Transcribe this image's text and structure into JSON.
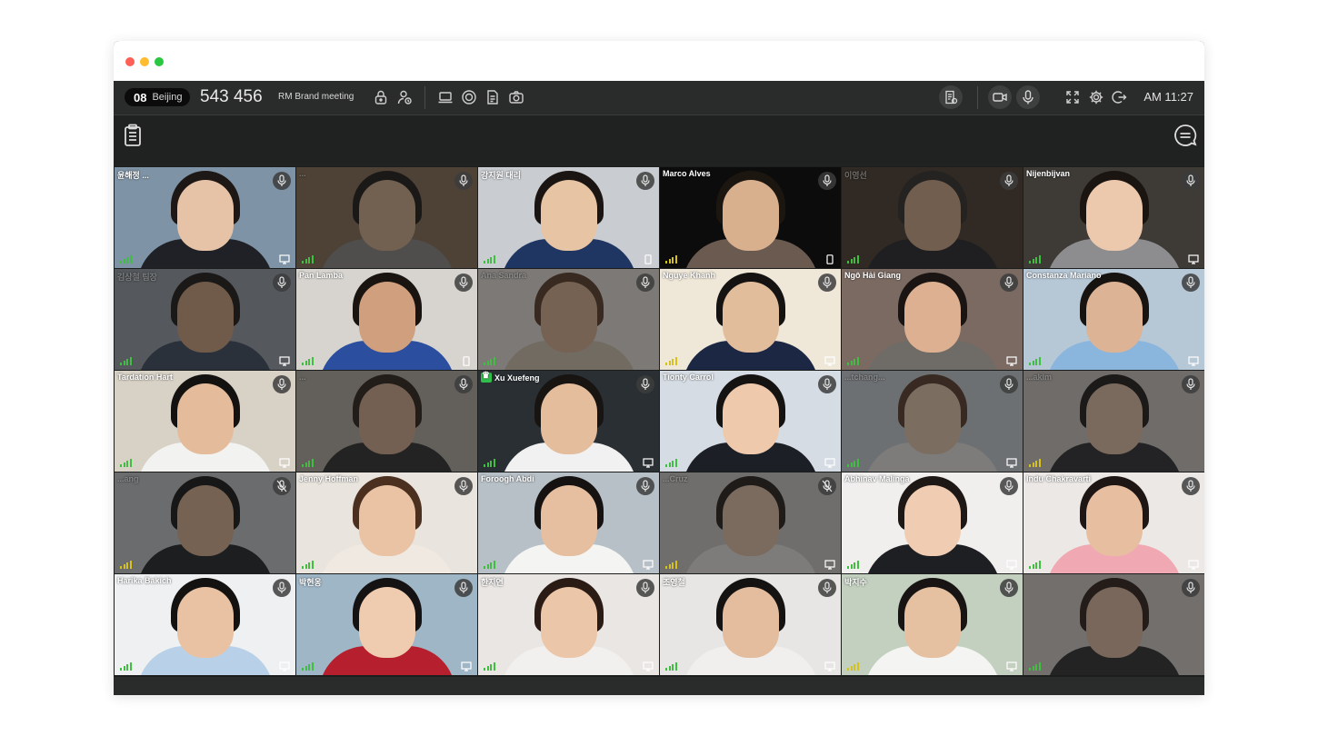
{
  "window_controls": [
    {
      "name": "close",
      "color": "#fe5f57"
    },
    {
      "name": "minimize",
      "color": "#febc2e"
    },
    {
      "name": "maximize",
      "color": "#28c840"
    }
  ],
  "toolbar": {
    "room_number": "08",
    "room_city": "Beijing",
    "meeting_id": "543 456",
    "meeting_name": "RM Brand meeting",
    "clock": "AM 11:27",
    "left_icons": [
      "lock-icon",
      "participants-icon"
    ],
    "center_icons": [
      "laptop-share-icon",
      "record-icon",
      "document-icon",
      "camera-icon"
    ],
    "right_icons": [
      "notes-icon",
      "video-icon",
      "mic-icon",
      "fullscreen-icon",
      "settings-icon",
      "exit-icon"
    ]
  },
  "subbar": {
    "left_icon": "clipboard-icon",
    "right_icon": "chat-icon"
  },
  "colors": {
    "signal_green": "#3fbf3f",
    "signal_yellow": "#d6c21b",
    "host_badge": "#2fbf4a"
  },
  "participants": [
    {
      "name": "윤해정 ...",
      "dim": false,
      "signal": "green",
      "device": "monitor",
      "mic": "on",
      "bg": "#7e93a5",
      "skin": "#e6c2a6",
      "hair": "#1d1715",
      "clothes": "#1f2126"
    },
    {
      "name": "...",
      "dim": true,
      "signal": "green",
      "device": "none",
      "mic": "on",
      "bg": "#8a6f56",
      "skin": "#d9b48f",
      "hair": "#1a1410",
      "clothes": "#8e8a86"
    },
    {
      "name": "강지원 대리",
      "dim": false,
      "signal": "green",
      "device": "tablet",
      "mic": "on",
      "bg": "#c9ccd0",
      "skin": "#e7c4a3",
      "hair": "#1a1512",
      "clothes": "#1f3562"
    },
    {
      "name": "Marco Alves",
      "dim": false,
      "signal": "yellow",
      "device": "tablet",
      "mic": "on",
      "bg": "#0c0c0c",
      "skin": "#d9b08e",
      "hair": "#1c1611",
      "clothes": "#6b5a4f"
    },
    {
      "name": "이영선",
      "dim": true,
      "signal": "green",
      "device": "none",
      "mic": "on",
      "bg": "#4a3b2e",
      "skin": "#d7ad8a",
      "hair": "#2e2a26",
      "clothes": "#222326"
    },
    {
      "name": "Nijenbijvan",
      "dim": false,
      "signal": "green",
      "device": "monitor",
      "mic": "on",
      "bg": "#3e3a36",
      "skin": "#ecc8ad",
      "hair": "#1b1512",
      "clothes": "#8d8c8e"
    },
    {
      "name": "김상철 팀장",
      "dim": true,
      "signal": "green",
      "device": "monitor",
      "mic": "on",
      "bg": "#9aa3ac",
      "skin": "#d4a582",
      "hair": "#191513",
      "clothes": "#3a4a5e"
    },
    {
      "name": "Pan Lamba",
      "dim": false,
      "signal": "green",
      "device": "tablet",
      "mic": "on",
      "bg": "#d7d4cf",
      "skin": "#cf9f7e",
      "hair": "#1a1411",
      "clothes": "#2b4f9e"
    },
    {
      "name": "Ana Sandra",
      "dim": true,
      "signal": "green",
      "device": "none",
      "mic": "on",
      "bg": "#efe9e2",
      "skin": "#e0b796",
      "hair": "#5a3a27",
      "clothes": "#d9c9b6"
    },
    {
      "name": "Nguye Khanh",
      "dim": false,
      "signal": "yellow",
      "device": "monitor",
      "mic": "on",
      "bg": "#efe8d9",
      "skin": "#e1bd9c",
      "hair": "#151312",
      "clothes": "#1c2744"
    },
    {
      "name": "Ngô Hải Giang",
      "dim": false,
      "signal": "green",
      "device": "monitor",
      "mic": "on",
      "bg": "#7a6a62",
      "skin": "#dcb090",
      "hair": "#1a1512",
      "clothes": "#6f6b66"
    },
    {
      "name": "Constanza Mariano",
      "dim": false,
      "signal": "green",
      "device": "monitor",
      "mic": "on",
      "bg": "#b6c7d6",
      "skin": "#dcb394",
      "hair": "#171311",
      "clothes": "#8ab5dd"
    },
    {
      "name": "Tardation Hart",
      "dim": false,
      "signal": "green",
      "device": "monitor",
      "mic": "on",
      "bg": "#d8d1c6",
      "skin": "#e4bc9b",
      "hair": "#141211",
      "clothes": "#f2f2f0"
    },
    {
      "name": "...",
      "dim": true,
      "signal": "green",
      "device": "none",
      "mic": "on",
      "bg": "#b9b2a9",
      "skin": "#dbb292",
      "hair": "#2a1e16",
      "clothes": "#2d2b2a"
    },
    {
      "name": "Xu Xuefeng",
      "host": true,
      "dim": false,
      "signal": "green",
      "device": "monitor",
      "mic": "on",
      "bg": "#2a2f33",
      "skin": "#e3bd9c",
      "hair": "#181412",
      "clothes": "#f1f1f1"
    },
    {
      "name": "Tionty Carrol",
      "dim": false,
      "signal": "green",
      "device": "monitor",
      "mic": "on",
      "bg": "#d6dce4",
      "skin": "#eec9ac",
      "hair": "#151212",
      "clothes": "#1c1f26"
    },
    {
      "name": "...tchang...",
      "dim": true,
      "signal": "green",
      "device": "monitor",
      "mic": "on",
      "bg": "#cfd6dc",
      "skin": "#efcfb4",
      "hair": "#5a3b28",
      "clothes": "#f1efec"
    },
    {
      "name": "...akim",
      "dim": true,
      "signal": "yellow",
      "device": "none",
      "mic": "on",
      "bg": "#d2ccc7",
      "skin": "#ebc8ae",
      "hair": "#1b1514",
      "clothes": "#2b2c30"
    },
    {
      "name": "...ang",
      "dim": true,
      "signal": "yellow",
      "device": "none",
      "mic": "off",
      "bg": "#c8cccf",
      "skin": "#dfb596",
      "hair": "#131110",
      "clothes": "#1e1f22"
    },
    {
      "name": "Jenny Hoffman",
      "dim": false,
      "signal": "green",
      "device": "none",
      "mic": "on",
      "bg": "#e9e4de",
      "skin": "#e9c3a4",
      "hair": "#4b2f1f",
      "clothes": "#efe9e1"
    },
    {
      "name": "Foroogh Abdi",
      "dim": false,
      "signal": "green",
      "device": "monitor",
      "mic": "on",
      "bg": "#b7c0c6",
      "skin": "#e5bf9f",
      "hair": "#151211",
      "clothes": "#f4f4f2"
    },
    {
      "name": "...Cruz",
      "dim": true,
      "signal": "yellow",
      "device": "monitor",
      "mic": "off",
      "bg": "#d4d1cd",
      "skin": "#ecc9ad",
      "hair": "#231a15",
      "clothes": "#f1efec"
    },
    {
      "name": "Abhinav Malinga",
      "dim": false,
      "signal": "green",
      "device": "monitor",
      "mic": "on",
      "bg": "#f0efee",
      "skin": "#f0cdb2",
      "hair": "#1d1716",
      "clothes": "#1e1f22"
    },
    {
      "name": "Indu Chakravarti",
      "dim": false,
      "signal": "green",
      "device": "monitor",
      "mic": "on",
      "bg": "#ece8e6",
      "skin": "#e8bea0",
      "hair": "#1e1614",
      "clothes": "#f0a9b2"
    },
    {
      "name": "Harika Bakich",
      "dim": false,
      "signal": "green",
      "device": "monitor",
      "mic": "on",
      "bg": "#eef0f2",
      "skin": "#e8c2a3",
      "hair": "#141211",
      "clothes": "#b8d0e8"
    },
    {
      "name": "박현옹",
      "dim": false,
      "signal": "green",
      "device": "monitor",
      "mic": "on",
      "bg": "#9fb6c6",
      "skin": "#efcbb0",
      "hair": "#141212",
      "clothes": "#b51f2e"
    },
    {
      "name": "한지연",
      "dim": false,
      "signal": "green",
      "device": "monitor",
      "mic": "on",
      "bg": "#e9e6e4",
      "skin": "#ecc6a8",
      "hair": "#2a1c15",
      "clothes": "#f2f0ee"
    },
    {
      "name": "조영철",
      "dim": false,
      "signal": "green",
      "device": "monitor",
      "mic": "on",
      "bg": "#e7e6e4",
      "skin": "#e3bd9e",
      "hair": "#151312",
      "clothes": "#f0efed"
    },
    {
      "name": "박지수",
      "dim": false,
      "signal": "yellow",
      "device": "monitor",
      "mic": "on",
      "bg": "#c3d0bf",
      "skin": "#e5c0a1",
      "hair": "#171413",
      "clothes": "#f4f4f2"
    },
    {
      "name": "",
      "dim": true,
      "signal": "green",
      "device": "none",
      "mic": "on",
      "bg": "#d9d3cd",
      "skin": "#e6c2a5",
      "hair": "#2a1c15",
      "clothes": "#2a2a2c"
    }
  ]
}
